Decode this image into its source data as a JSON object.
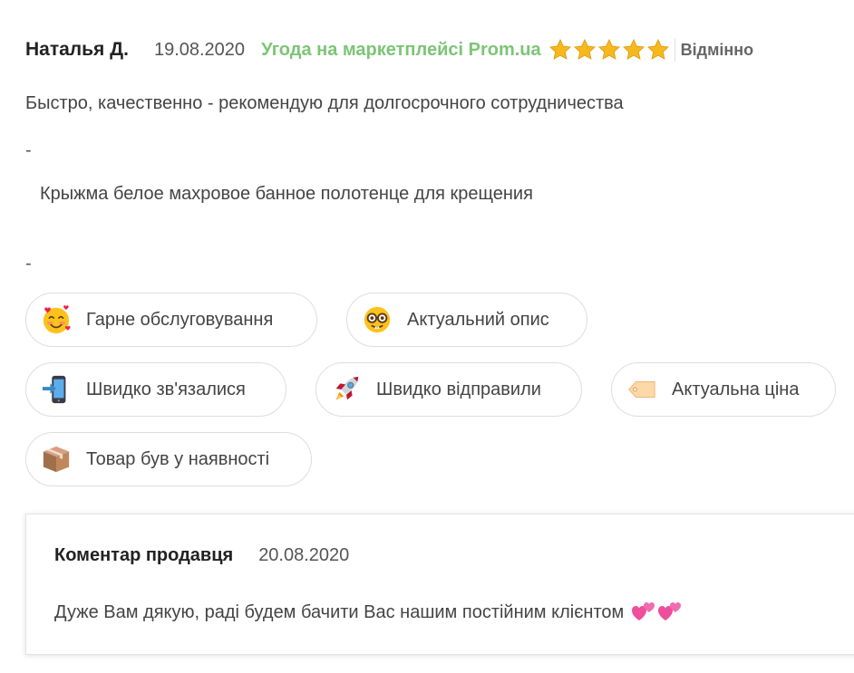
{
  "review": {
    "author": "Наталья Д.",
    "date": "19.08.2020",
    "deal_label": "Угода на маркетплейсі Prom.ua",
    "rating": 5,
    "rating_max": 5,
    "rating_label": "Відмінно",
    "text": "Быстро, качественно - рекомендую для долгосрочного сотрудничества",
    "separator_1": "-",
    "product": "Крыжма белое махровое банное полотенце для крещения",
    "separator_2": "-"
  },
  "tags": [
    {
      "label": "Гарне обслуговування",
      "icon": "smiling-face-with-hearts-icon"
    },
    {
      "label": "Актуальний опис",
      "icon": "nerd-face-icon"
    },
    {
      "label": "Швидко зв'язалися",
      "icon": "mobile-phone-arrow-icon"
    },
    {
      "label": "Швидко відправили",
      "icon": "rocket-icon"
    },
    {
      "label": "Актуальна ціна",
      "icon": "price-tag-icon"
    },
    {
      "label": "Товар був у наявності",
      "icon": "package-icon"
    }
  ],
  "seller_reply": {
    "title": "Коментар продавця",
    "date": "20.08.2020",
    "text": "Дуже Вам дякую, раді будем бачити Вас нашим постійним клієнтом",
    "emoji": "two-hearts-icon"
  },
  "colors": {
    "deal_green": "#7cc576",
    "star_gold": "#f5b91f",
    "tag_border": "#dedede",
    "heart_pink": "#ee4f9a"
  }
}
